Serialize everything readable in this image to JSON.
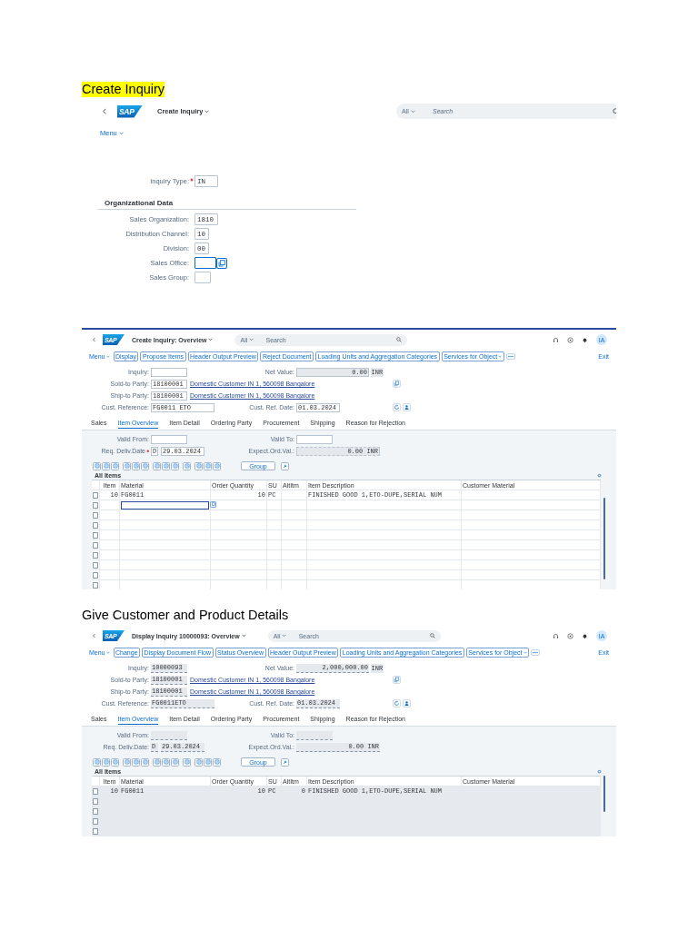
{
  "sections": [
    {
      "heading": {
        "text": "Create Inquiry",
        "highlighted": true
      },
      "screen": {
        "kind": "initial",
        "shell": {
          "logo": "SAP",
          "title": "Create Inquiry",
          "scope": "All",
          "search_placeholder": "Search"
        },
        "menu": "Menu",
        "fields": [
          {
            "label": "Inquiry Type:",
            "required": true,
            "value": "IN",
            "focused": false
          }
        ],
        "group": {
          "title": "Organizational Data",
          "fields": [
            {
              "label": "Sales Organization:",
              "required": false,
              "value": "1810",
              "focused": false
            },
            {
              "label": "Distribution Channel:",
              "required": false,
              "value": "10",
              "focused": false
            },
            {
              "label": "Division:",
              "required": false,
              "value": "00",
              "focused": false
            },
            {
              "label": "Sales Office:",
              "required": false,
              "focused": true
            },
            {
              "label": "Sales Group:",
              "required": false,
              "focused": false
            }
          ]
        }
      }
    },
    {
      "screen": {
        "kind": "overview",
        "editable": true,
        "shell": {
          "logo": "SAP",
          "title": "Create Inquiry: Overview",
          "scope": "All",
          "search_placeholder": "Search",
          "user": "IA"
        },
        "toolbar": {
          "menu": "Menu",
          "buttons": [
            {
              "label": "Display",
              "dropdown": false
            },
            {
              "label": "Propose Items",
              "dropdown": false
            },
            {
              "label": "Header Output Preview",
              "dropdown": false
            },
            {
              "label": "Reject Document",
              "dropdown": false
            },
            {
              "label": "Loading Units and Aggregation Categories",
              "dropdown": false
            },
            {
              "label": "Services for Object",
              "dropdown": true
            }
          ],
          "exit": "Exit"
        },
        "header": [
          {
            "label": "Inquiry:",
            "right": {
              "label": "Net Value:",
              "value": "0.00",
              "unit": "INR"
            }
          },
          {
            "label": "Sold-to Party:",
            "value": "18100001",
            "description": "Domestic Customer IN 1, 560098 Bangalore"
          },
          {
            "label": "Ship-to Party:",
            "value": "18100001",
            "description": "Domestic Customer IN 1, 560098 Bangalore"
          },
          {
            "label": "Cust. Reference:",
            "value": "FG0011 ETO",
            "right": {
              "label": "Cust. Ref. Date:",
              "value": "01.03.2024"
            }
          }
        ],
        "tabs": [
          {
            "label": "Sales",
            "selected": false
          },
          {
            "label": "Item Overview",
            "selected": true
          },
          {
            "label": "Item Detail",
            "selected": false
          },
          {
            "label": "Ordering Party",
            "selected": false
          },
          {
            "label": "Procurement",
            "selected": false
          },
          {
            "label": "Shipping",
            "selected": false
          },
          {
            "label": "Reason for Rejection",
            "selected": false
          }
        ],
        "items": {
          "valid_from": "Valid From:",
          "valid_to": "Valid To:",
          "delivery": {
            "label": "Req. Deliv.Date",
            "required": true,
            "unit": "D",
            "value": "29.03.2024"
          },
          "expected": {
            "label": "Expect.Ord.Val.:",
            "value": "0.00 INR"
          }
        },
        "group_button": "Group",
        "table": {
          "title": "All Items",
          "columns": [
            "Item",
            "Material",
            "Order Quantity",
            "SU",
            "AltItm",
            "Item Description",
            "Customer Material"
          ],
          "rows": [
            {
              "selected": false,
              "editing": false,
              "cells": {
                "item": "10",
                "material": "FG0011",
                "quantity": "10",
                "su": "PC",
                "description": "FINISHED GOOD 1,ETO-DUPE,SERIAL NUM"
              }
            },
            {
              "selected": false,
              "editing": true
            },
            {
              "selected": false,
              "editing": false
            },
            {
              "selected": false,
              "editing": false
            },
            {
              "selected": false,
              "editing": false
            },
            {
              "selected": false,
              "editing": false
            },
            {
              "selected": false,
              "editing": false
            },
            {
              "selected": false,
              "editing": false
            },
            {
              "selected": false,
              "editing": false
            },
            {
              "selected": false,
              "editing": false
            }
          ]
        }
      }
    },
    {
      "heading": {
        "text": "Give Customer and Product Details",
        "highlighted": false
      },
      "screen": {
        "kind": "overview",
        "editable": false,
        "shell": {
          "logo": "SAP",
          "title": "Display Inquiry 10000093: Overview",
          "scope": "All",
          "search_placeholder": "Search",
          "user": "IA"
        },
        "toolbar": {
          "menu": "Menu",
          "buttons": [
            {
              "label": "Change",
              "dropdown": false
            },
            {
              "label": "Display Document Flow",
              "dropdown": false
            },
            {
              "label": "Status Overview",
              "dropdown": false
            },
            {
              "label": "Header Output Preview",
              "dropdown": false
            },
            {
              "label": "Loading Units and Aggregation Categories",
              "dropdown": false
            },
            {
              "label": "Services for Object",
              "dropdown": true
            }
          ],
          "exit": "Exit"
        },
        "header": [
          {
            "label": "Inquiry:",
            "value": "10000093",
            "right": {
              "label": "Net Value:",
              "value": "2,000,000.00",
              "unit": "INR"
            }
          },
          {
            "label": "Sold-to Party:",
            "value": "18100001",
            "description": "Domestic Customer IN 1, 560098 Bangalore"
          },
          {
            "label": "Ship-to Party:",
            "value": "18100001",
            "description": "Domestic Customer IN 1, 560098 Bangalore"
          },
          {
            "label": "Cust. Reference:",
            "value": "FG0011ETO",
            "right": {
              "label": "Cust. Ref. Date:",
              "value": "01.03.2024"
            }
          }
        ],
        "tabs": [
          {
            "label": "Sales",
            "selected": false
          },
          {
            "label": "Item Overview",
            "selected": true
          },
          {
            "label": "Item Detail",
            "selected": false
          },
          {
            "label": "Ordering Party",
            "selected": false
          },
          {
            "label": "Procurement",
            "selected": false
          },
          {
            "label": "Shipping",
            "selected": false
          },
          {
            "label": "Reason for Rejection",
            "selected": false
          }
        ],
        "items": {
          "valid_from": "Valid From:",
          "valid_to": "Valid To:",
          "delivery": {
            "label": "Req. Deliv.Date:",
            "required": false,
            "unit": "D",
            "value": "29.03.2024"
          },
          "expected": {
            "label": "Expect.Ord.Val.:",
            "value": "0.00 INR"
          }
        },
        "group_button": "Group",
        "table": {
          "title": "All Items",
          "columns": [
            "Item",
            "Material",
            "Order Quantity",
            "SU",
            "AltItm",
            "Item Description",
            "Customer Material"
          ],
          "rows": [
            {
              "selected": false,
              "editing": false,
              "cells": {
                "item": "10",
                "material": "FG0011",
                "quantity": "10",
                "su": "PC",
                "alt_item": "0",
                "description": "FINISHED GOOD 1,ETO-DUPE,SERIAL NUM"
              }
            },
            {
              "selected": false,
              "editing": false
            },
            {
              "selected": false,
              "editing": false
            },
            {
              "selected": false,
              "editing": false
            },
            {
              "selected": false,
              "editing": false
            }
          ]
        }
      }
    }
  ]
}
